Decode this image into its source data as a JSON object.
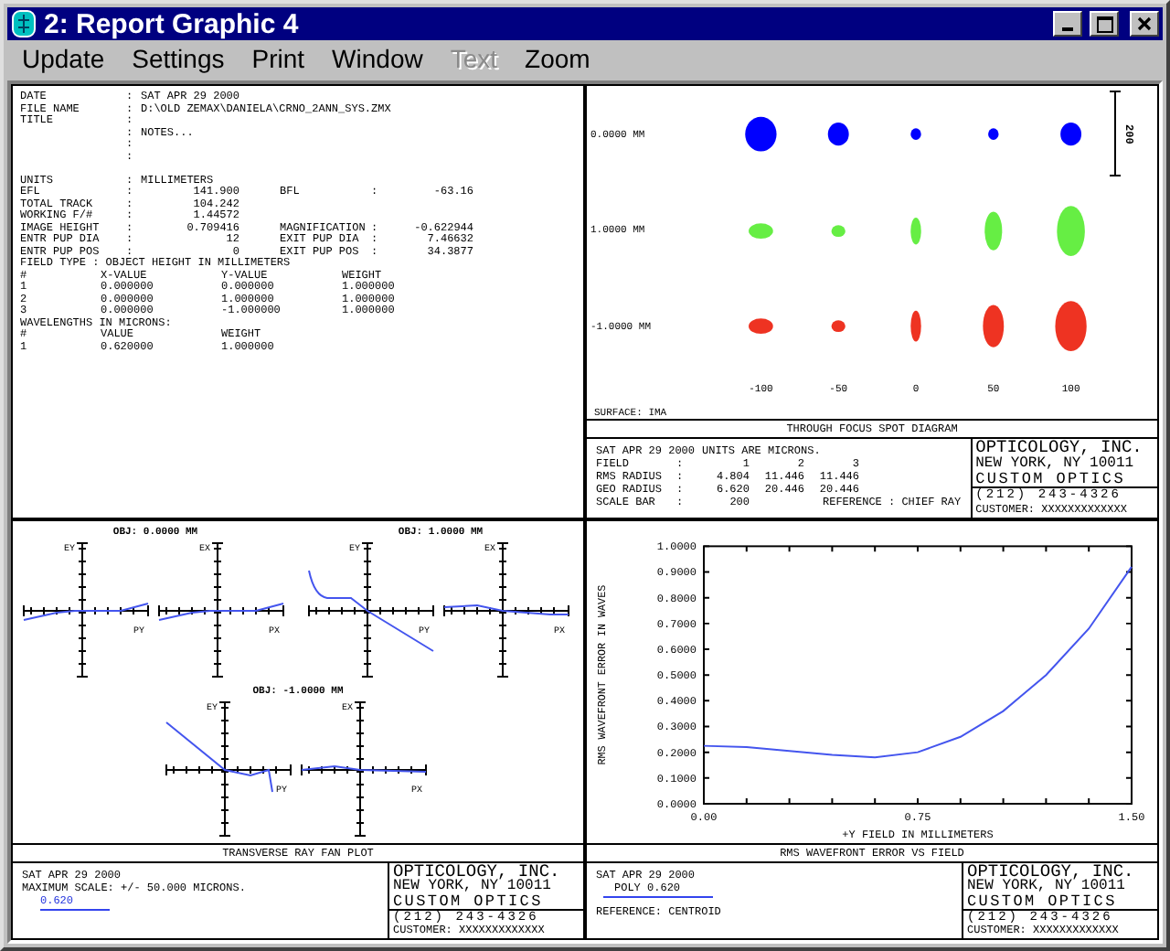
{
  "window": {
    "title": "2: Report Graphic 4"
  },
  "menu": [
    {
      "label": "Update",
      "disabled": false
    },
    {
      "label": "Settings",
      "disabled": false
    },
    {
      "label": "Print",
      "disabled": false
    },
    {
      "label": "Window",
      "disabled": false
    },
    {
      "label": "Text",
      "disabled": true
    },
    {
      "label": "Zoom",
      "disabled": false
    }
  ],
  "report": {
    "header": [
      {
        "label": "DATE",
        "sep": ":",
        "value": "SAT APR 29 2000"
      },
      {
        "label": "FILE NAME",
        "sep": ":",
        "value": "D:\\OLD ZEMAX\\DANIELA\\CRNO_2ANN_SYS.ZMX"
      },
      {
        "label": "TITLE",
        "sep": ":"
      },
      {
        "sep": ":",
        "value": "NOTES..."
      },
      {
        "sep": ":"
      },
      {
        "sep": ":"
      }
    ],
    "system": [
      {
        "label": "UNITS",
        "sep": ":",
        "value": "MILLIMETERS"
      },
      {
        "label": "EFL",
        "sep": ":",
        "value": "141.900",
        "label2": "BFL",
        "sep2": ":",
        "value2": "-63.16"
      },
      {
        "label": "TOTAL TRACK",
        "sep": ":",
        "value": "104.242"
      },
      {
        "label": "WORKING F/#",
        "sep": ":",
        "value": "1.44572"
      },
      {
        "label": "IMAGE HEIGHT",
        "sep": ":",
        "value": "0.709416",
        "label2": "MAGNIFICATION",
        "sep2": ":",
        "value2": "-0.622944"
      },
      {
        "label": "ENTR PUP DIA",
        "sep": ":",
        "value": "12",
        "label2": "EXIT PUP DIA",
        "sep2": ":",
        "value2": "7.46632"
      },
      {
        "label": "ENTR PUP POS",
        "sep": ":",
        "value": "0",
        "label2": "EXIT PUP POS",
        "sep2": ":",
        "value2": "34.3877"
      }
    ],
    "fields": {
      "heading": "FIELD TYPE : OBJECT HEIGHT IN MILLIMETERS",
      "columns": [
        "#",
        "X-VALUE",
        "Y-VALUE",
        "WEIGHT"
      ],
      "rows": [
        [
          "1",
          "0.000000",
          "0.000000",
          "1.000000"
        ],
        [
          "2",
          "0.000000",
          "1.000000",
          "1.000000"
        ],
        [
          "3",
          "0.000000",
          "-1.000000",
          "1.000000"
        ]
      ]
    },
    "wavelengths": {
      "heading": "WAVELENGTHS IN MICRONS:",
      "columns": [
        "#",
        "VALUE",
        "WEIGHT"
      ],
      "rows": [
        [
          "1",
          "0.620000",
          "1.000000"
        ]
      ]
    }
  },
  "spot_diagram": {
    "rows": [
      {
        "label": "0.0000 MM",
        "color": "#0000ff"
      },
      {
        "label": "1.0000 MM",
        "color": "#66ee44"
      },
      {
        "label": "-1.0000 MM",
        "color": "#ee3322"
      }
    ],
    "columns": [
      "-100",
      "-50",
      "0",
      "50",
      "100"
    ],
    "scale_label": "200",
    "surface": "SURFACE: IMA",
    "caption": "THROUGH FOCUS SPOT DIAGRAM",
    "info": {
      "date": "SAT APR 29 2000",
      "units": "UNITS ARE MICRONS.",
      "stats": [
        {
          "label": "FIELD",
          "sep": ":",
          "values": [
            "1",
            "2",
            "3"
          ]
        },
        {
          "label": "RMS RADIUS",
          "sep": ":",
          "values": [
            "4.804",
            "11.446",
            "11.446"
          ]
        },
        {
          "label": "GEO RADIUS",
          "sep": ":",
          "values": [
            "6.620",
            "20.446",
            "20.446"
          ]
        },
        {
          "label": "SCALE BAR",
          "sep": ":",
          "values": [
            "200"
          ]
        }
      ],
      "reference": "REFERENCE : CHIEF RAY"
    },
    "company": {
      "name": "OPTICOLOGY, INC.",
      "address": "NEW YORK, NY 10011",
      "tagline": "CUSTOM OPTICS",
      "phone": "(212) 243-4326",
      "customer": "CUSTOMER: XXXXXXXXXXXXX"
    }
  },
  "ray_fan": {
    "plots": [
      {
        "title": "OBJ: 0.0000 MM",
        "fans": [
          {
            "ylabel": "EY",
            "xlabel": "PY"
          },
          {
            "ylabel": "EX",
            "xlabel": "PX"
          }
        ]
      },
      {
        "title": "OBJ: 1.0000 MM",
        "fans": [
          {
            "ylabel": "EY",
            "xlabel": "PY"
          },
          {
            "ylabel": "EX",
            "xlabel": "PX"
          }
        ]
      },
      {
        "title": "OBJ: -1.0000 MM",
        "fans": [
          {
            "ylabel": "EY",
            "xlabel": "PY"
          },
          {
            "ylabel": "EX",
            "xlabel": "PX"
          }
        ]
      }
    ],
    "caption": "TRANSVERSE RAY FAN PLOT",
    "info": {
      "date": "SAT APR 29 2000",
      "scale": "MAXIMUM SCALE: +/- 50.000 MICRONS.",
      "legend": "0.620"
    },
    "company": {
      "name": "OPTICOLOGY, INC.",
      "address": "NEW YORK, NY 10011",
      "tagline": "CUSTOM OPTICS",
      "phone": "(212) 243-4326",
      "customer": "CUSTOMER: XXXXXXXXXXXXX"
    }
  },
  "wavefront": {
    "chart_data": {
      "type": "line",
      "xlabel": "+Y FIELD IN MILLIMETERS",
      "ylabel": "RMS WAVEFRONT ERROR IN WAVES",
      "x": [
        0,
        0.15,
        0.3,
        0.45,
        0.6,
        0.75,
        0.9,
        1.05,
        1.2,
        1.35,
        1.5
      ],
      "series": [
        {
          "color": "#4455ee",
          "values": [
            0.225,
            0.22,
            0.205,
            0.19,
            0.18,
            0.2,
            0.26,
            0.36,
            0.5,
            0.68,
            0.92
          ]
        }
      ],
      "xlim": [
        0,
        1.5
      ],
      "ylim": [
        0,
        1
      ],
      "xticks": [
        {
          "value": 0,
          "label": "0.00"
        },
        {
          "value": 0.75,
          "label": "0.75"
        },
        {
          "value": 1.5,
          "label": "1.50"
        }
      ],
      "yticks": [
        {
          "value": 0,
          "label": "0.0000"
        },
        {
          "value": 0.1,
          "label": "0.1000"
        },
        {
          "value": 0.2,
          "label": "0.2000"
        },
        {
          "value": 0.3,
          "label": "0.3000"
        },
        {
          "value": 0.4,
          "label": "0.4000"
        },
        {
          "value": 0.5,
          "label": "0.5000"
        },
        {
          "value": 0.6,
          "label": "0.6000"
        },
        {
          "value": 0.7,
          "label": "0.7000"
        },
        {
          "value": 0.8,
          "label": "0.8000"
        },
        {
          "value": 0.9,
          "label": "0.9000"
        },
        {
          "value": 1,
          "label": "1.0000"
        }
      ]
    },
    "caption": "RMS WAVEFRONT ERROR VS FIELD",
    "info": {
      "date": "SAT APR 29 2000",
      "legend_label": "POLY",
      "legend": "0.620",
      "reference": "REFERENCE: CENTROID"
    },
    "company": {
      "name": "OPTICOLOGY, INC.",
      "address": "NEW YORK, NY 10011",
      "tagline": "CUSTOM OPTICS",
      "phone": "(212) 243-4326",
      "customer": "CUSTOMER: XXXXXXXXXXXXX"
    }
  }
}
